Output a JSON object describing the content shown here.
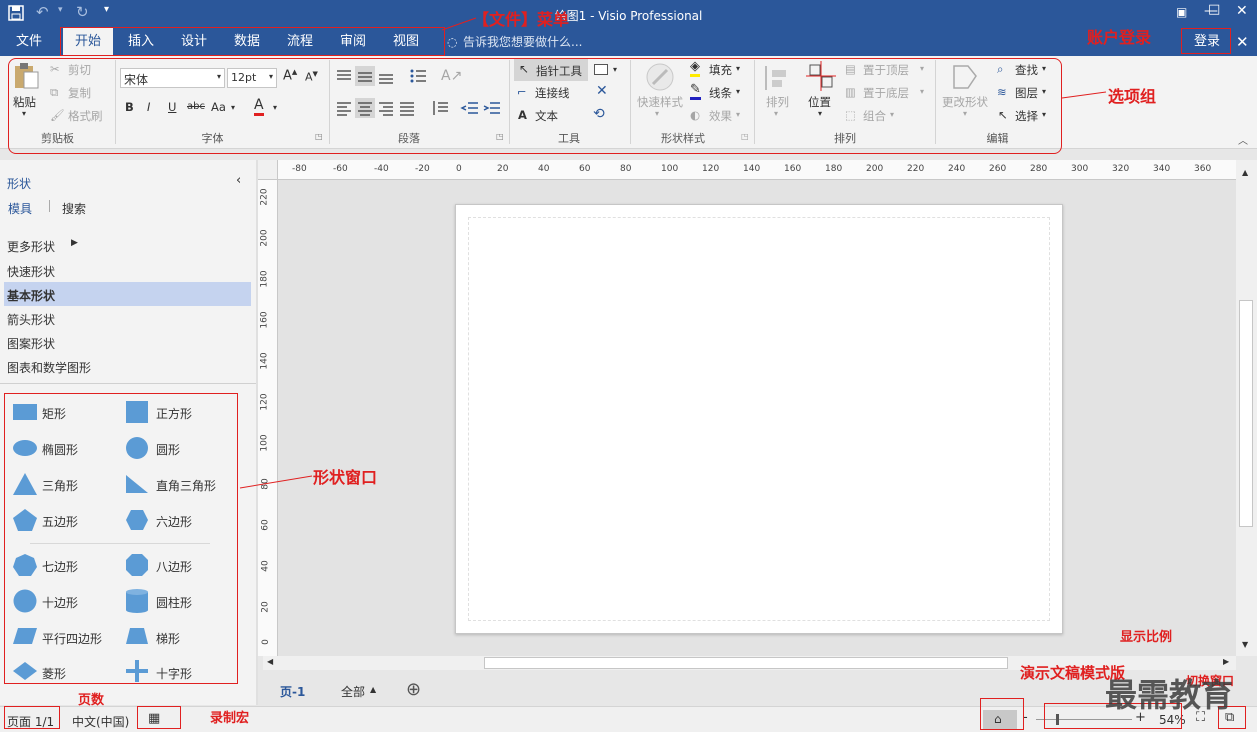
{
  "window": {
    "title": "绘图1 - Visio Professional"
  },
  "tabs": [
    "文件",
    "开始",
    "插入",
    "设计",
    "数据",
    "流程",
    "审阅",
    "视图"
  ],
  "tellme": "告诉我您想要做什么...",
  "account": {
    "login": "登录"
  },
  "ribbon": {
    "clipboard": {
      "paste": "粘贴",
      "cut": "剪切",
      "copy": "复制",
      "format_painter": "格式刷",
      "label": "剪贴板"
    },
    "font": {
      "name": "宋体",
      "size": "12pt",
      "label": "字体",
      "case": "Aa"
    },
    "paragraph": {
      "label": "段落"
    },
    "tools": {
      "pointer": "指针工具",
      "connector": "连接线",
      "text": "文本",
      "label": "工具"
    },
    "shape_styles": {
      "quick": "快速样式",
      "fill": "填充",
      "line": "线条",
      "effect": "效果",
      "label": "形状样式"
    },
    "arrange": {
      "arrange": "排列",
      "position": "位置",
      "bring_front": "置于顶层",
      "send_back": "置于底层",
      "group": "组合",
      "label": "排列"
    },
    "editing": {
      "change_shape": "更改形状",
      "find": "查找",
      "layers": "图层",
      "select": "选择",
      "label": "编辑"
    }
  },
  "shapes_pane": {
    "title": "形状",
    "tab_stencils": "模具",
    "tab_search": "搜索",
    "categories": [
      "更多形状",
      "快速形状",
      "基本形状",
      "箭头形状",
      "图案形状",
      "图表和数学图形"
    ],
    "shapes": [
      "矩形",
      "正方形",
      "椭圆形",
      "圆形",
      "三角形",
      "直角三角形",
      "五边形",
      "六边形",
      "七边形",
      "八边形",
      "十边形",
      "圆柱形",
      "平行四边形",
      "梯形",
      "菱形",
      "十字形"
    ]
  },
  "ruler": {
    "top": [
      "-80",
      "-60",
      "-40",
      "-20",
      "0",
      "20",
      "40",
      "60",
      "80",
      "100",
      "120",
      "140",
      "160",
      "180",
      "200",
      "220",
      "240",
      "260",
      "280",
      "300",
      "320",
      "340",
      "360"
    ],
    "left": [
      "220",
      "200",
      "180",
      "160",
      "140",
      "120",
      "100",
      "80",
      "60",
      "40",
      "20",
      "0"
    ]
  },
  "page_tabs": {
    "current": "页-1",
    "all": "全部"
  },
  "status": {
    "page": "页面 1/1",
    "language": "中文(中国)",
    "zoom": "54%"
  },
  "annotations": {
    "file_menu": "【文件】菜单",
    "account": "账户登录",
    "ribbon": "选项组",
    "shapes": "形状窗口",
    "page_count": "页数",
    "macro": "录制宏",
    "presentation": "演示文稿模式版",
    "zoom": "显示比例",
    "switch": "切换窗口"
  },
  "watermark": "最需教育",
  "colors": {
    "accent": "#2b579a",
    "annotation": "#e02020",
    "selected": "#c5d3ef",
    "shape_blue": "#5b9bd5"
  }
}
